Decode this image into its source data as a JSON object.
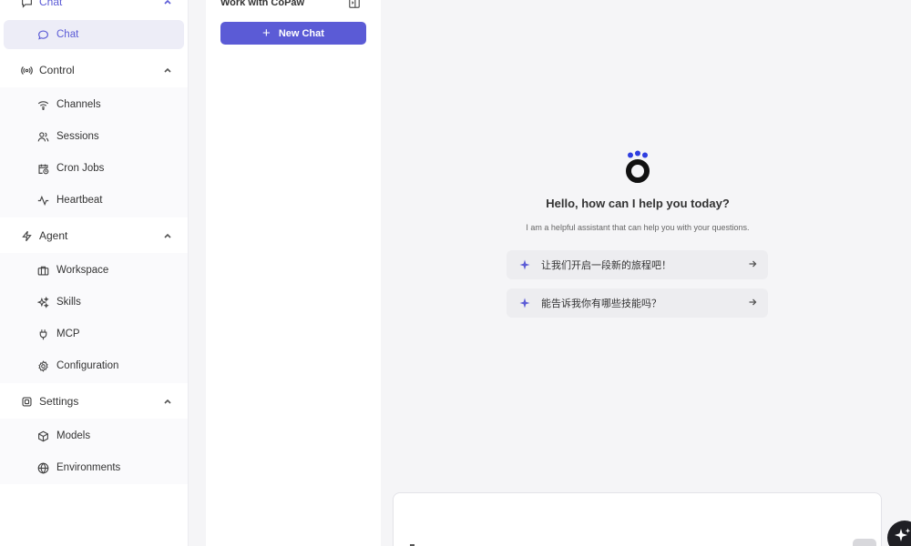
{
  "sidebar": {
    "groups": [
      {
        "label": "Chat",
        "icon": "chat-bubble-icon",
        "items": [
          {
            "label": "Chat",
            "icon": "chat-bubble-icon",
            "active": true
          }
        ]
      },
      {
        "label": "Control",
        "icon": "broadcast-icon",
        "items": [
          {
            "label": "Channels",
            "icon": "wifi-icon"
          },
          {
            "label": "Sessions",
            "icon": "users-icon"
          },
          {
            "label": "Cron Jobs",
            "icon": "calendar-clock-icon"
          },
          {
            "label": "Heartbeat",
            "icon": "activity-icon"
          }
        ]
      },
      {
        "label": "Agent",
        "icon": "zap-icon",
        "items": [
          {
            "label": "Workspace",
            "icon": "briefcase-icon"
          },
          {
            "label": "Skills",
            "icon": "sparkles-icon"
          },
          {
            "label": "MCP",
            "icon": "plug-icon"
          },
          {
            "label": "Configuration",
            "icon": "gear-icon"
          }
        ]
      },
      {
        "label": "Settings",
        "icon": "cpu-icon",
        "items": [
          {
            "label": "Models",
            "icon": "box-icon"
          },
          {
            "label": "Environments",
            "icon": "globe-icon"
          }
        ]
      }
    ]
  },
  "chat_list": {
    "title": "Work with CoPaw",
    "new_chat_label": "New Chat"
  },
  "welcome": {
    "greeting": "Hello, how can I help you today?",
    "subtitle": "I am a helpful assistant that can help you with your questions.",
    "suggestions": [
      "让我们开启一段新的旅程吧！",
      "能告诉我你有哪些技能吗？"
    ]
  },
  "colors": {
    "accent": "#5b5bd6",
    "background": "#f5f5f7",
    "sidebar_active": "#ededf7"
  }
}
